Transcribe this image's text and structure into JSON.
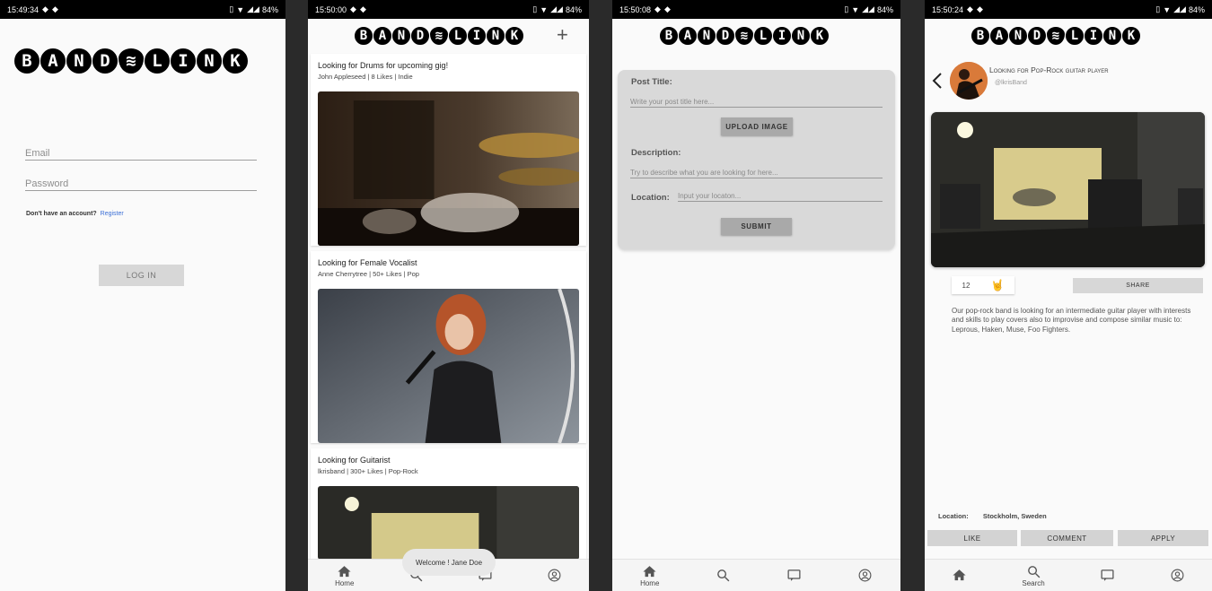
{
  "brand": {
    "letters_left": [
      "B",
      "A",
      "N",
      "D"
    ],
    "letters_right": [
      "L",
      "I",
      "N",
      "K"
    ]
  },
  "screen1": {
    "time": "15:49:34",
    "battery": "84%",
    "email_placeholder": "Email",
    "password_placeholder": "Password",
    "no_account_text": "Don't have an account?",
    "register_link": "Register",
    "login_button": "LOG IN"
  },
  "screen2": {
    "time": "15:50:00",
    "battery": "84%",
    "add_icon": "+",
    "posts": [
      {
        "title": "Looking for Drums for upcoming gig!",
        "meta": "John Appleseed | 8 Likes | Indie"
      },
      {
        "title": "Looking for Female Vocalist",
        "meta": "Anne Cherrytree | 50+ Likes | Pop"
      },
      {
        "title": "Looking for Guitarist",
        "meta": "lkrisband | 300+ Likes | Pop-Rock"
      }
    ],
    "toast": "Welcome ! Jane Doe",
    "nav": {
      "home": "Home"
    }
  },
  "screen3": {
    "time": "15:50:08",
    "battery": "84%",
    "post_title_label": "Post Title:",
    "post_title_placeholder": "Write your post title here...",
    "upload_button": "UPLOAD IMAGE",
    "description_label": "Description:",
    "description_placeholder": "Try to describe what you are looking for here...",
    "location_label": "Location:",
    "location_placeholder": "Input your locaton...",
    "submit_button": "SUBMIT",
    "nav": {
      "home": "Home"
    }
  },
  "screen4": {
    "time": "15:50:24",
    "battery": "84%",
    "post_title": "Looking for Pop-Rock guitar player",
    "handle": "@lkrisBand",
    "like_count": "12",
    "share_button": "SHARE",
    "description": "Our pop-rock band is looking for an intermediate guitar player with interests and skills to play covers also to improvise and compose similar music to: Leprous, Haken, Muse, Foo Fighters.",
    "location_label": "Location:",
    "location_value": "Stockholm, Sweden",
    "like_button": "LIKE",
    "comment_button": "COMMENT",
    "apply_button": "APPLY",
    "nav": {
      "search": "Search"
    }
  },
  "colors": {
    "link": "#3b6fd6",
    "button_grey": "#d7d7d7"
  }
}
